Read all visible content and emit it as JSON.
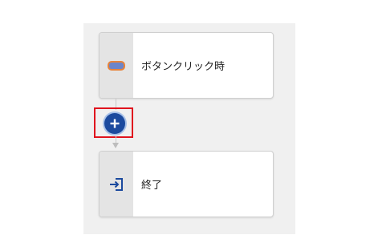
{
  "flow": {
    "trigger": {
      "label": "ボタンクリック時",
      "icon": "button-pill-icon",
      "icon_fill": "#6c85c9",
      "icon_border": "#e8833a"
    },
    "add_step": {
      "icon": "plus-icon",
      "button_color": "#1c4a9e",
      "highlight_color": "#e0141e"
    },
    "end": {
      "label": "終了",
      "icon": "exit-icon",
      "icon_color": "#1c4a9e"
    }
  }
}
